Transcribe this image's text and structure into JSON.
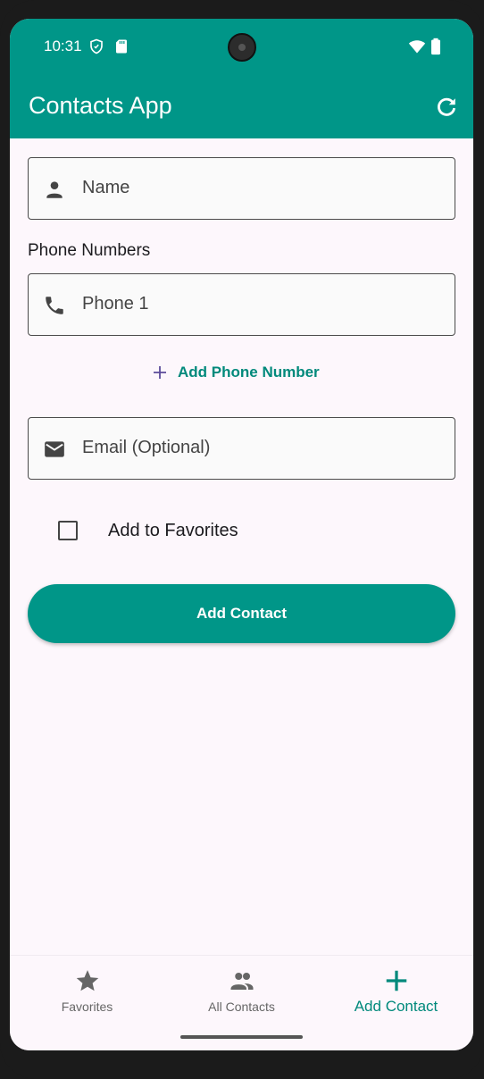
{
  "status_bar": {
    "time": "10:31"
  },
  "app_bar": {
    "title": "Contacts App",
    "background_color": "#009688",
    "refresh_icon": "refresh-icon"
  },
  "form": {
    "name_placeholder": "Name",
    "phone_section_label": "Phone Numbers",
    "phone_placeholder": "Phone 1",
    "add_phone_label": "Add Phone Number",
    "email_placeholder": "Email (Optional)",
    "favorite_label": "Add to Favorites",
    "favorite_checked": false,
    "submit_label": "Add Contact"
  },
  "bottom_nav": {
    "items": [
      {
        "label": "Favorites",
        "icon": "star-icon",
        "active": false
      },
      {
        "label": "All Contacts",
        "icon": "people-icon",
        "active": false
      },
      {
        "label": "Add Contact",
        "icon": "plus-icon",
        "active": true
      }
    ]
  },
  "colors": {
    "accent": "#009688",
    "accent_text": "#00897b",
    "background": "#fdf7fc"
  }
}
